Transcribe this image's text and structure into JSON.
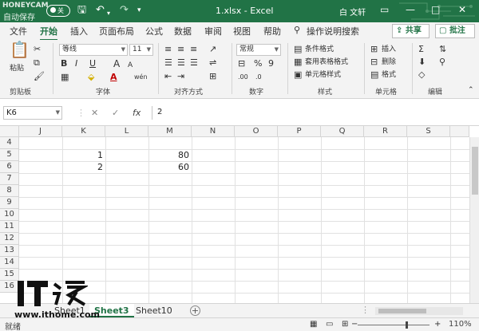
{
  "titlebar": {
    "watermark": "HONEYCAM",
    "autosave": "自动保存",
    "toggle": "关",
    "doc_title": "1.xlsx  -  Excel",
    "user": "白 文轩",
    "save_icon": "save-icon",
    "undo_icon": "undo-icon",
    "redo_icon": "redo-icon"
  },
  "tabs": [
    "文件",
    "开始",
    "插入",
    "页面布局",
    "公式",
    "数据",
    "审阅",
    "视图",
    "帮助"
  ],
  "active_tab": "开始",
  "search": {
    "placeholder": "操作说明搜索"
  },
  "share_label": "共享",
  "notes_label": "批注",
  "ribbon": {
    "paste_label": "粘贴",
    "clipboard_label": "剪贴板",
    "font_label": "字体",
    "font_name": "等线",
    "font_size": "11",
    "align_label": "对齐方式",
    "number_label": "数字",
    "number_format": "常规",
    "styles_label": "样式",
    "conditional": "条件格式",
    "table_format": "套用表格格式",
    "cell_style": "单元格样式",
    "cells_label": "单元格",
    "insert": "插入",
    "delete": "删除",
    "format": "格式",
    "edit_label": "编辑",
    "bold": "B",
    "italic": "I",
    "underline": "U",
    "grow_font": "A",
    "shrink_font": "A"
  },
  "formula_bar": {
    "name_box": "K6",
    "value": "2",
    "fx": "fx",
    "cancel": "✕",
    "confirm": "✓"
  },
  "grid": {
    "columns": [
      "J",
      "K",
      "L",
      "M",
      "N",
      "O",
      "P",
      "Q",
      "R",
      "S"
    ],
    "rows": [
      "4",
      "5",
      "6",
      "7",
      "8",
      "9",
      "10",
      "11",
      "12",
      "13",
      "14",
      "15",
      "16"
    ],
    "cells": [
      {
        "ref": "K5",
        "value": "1"
      },
      {
        "ref": "M5",
        "value": "80"
      },
      {
        "ref": "K6",
        "value": "2"
      },
      {
        "ref": "M6",
        "value": "60"
      }
    ]
  },
  "sheets": [
    "Sheet1",
    "Sheet3",
    "Sheet10"
  ],
  "active_sheet": "Sheet3",
  "status": {
    "mode": "就绪",
    "zoom": "110%"
  },
  "watermark": {
    "logo_text": "IT之家",
    "url": "www.ithome.com"
  },
  "colors": {
    "accent": "#217346",
    "ribbon_bg": "#f3f3f3"
  }
}
